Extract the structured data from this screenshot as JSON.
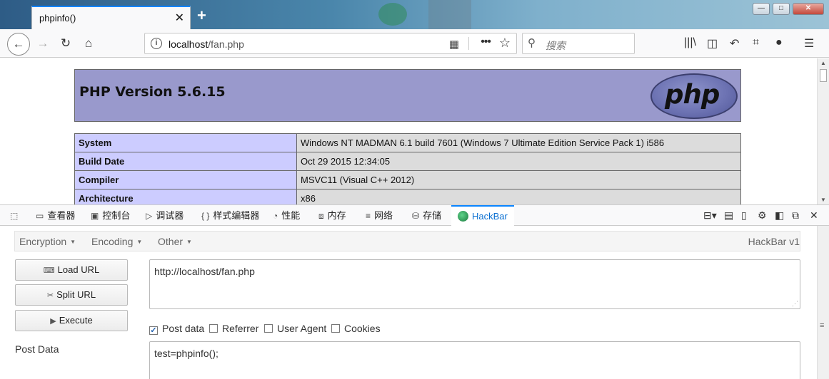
{
  "browser": {
    "tab_title": "phpinfo()",
    "tab_close": "✕",
    "new_tab": "+",
    "win_min": "—",
    "win_max": "□",
    "win_close": "✕",
    "url_host": "localhost",
    "url_path": "/fan.php",
    "search_placeholder": "搜索"
  },
  "page": {
    "php_version": "PHP Version 5.6.15",
    "logo_text": "php",
    "rows": [
      {
        "key": "System",
        "value": "Windows NT MADMAN 6.1 build 7601 (Windows 7 Ultimate Edition Service Pack 1) i586"
      },
      {
        "key": "Build Date",
        "value": "Oct 29 2015 12:34:05"
      },
      {
        "key": "Compiler",
        "value": "MSVC11 (Visual C++ 2012)"
      },
      {
        "key": "Architecture",
        "value": "x86"
      }
    ]
  },
  "devtools": {
    "tabs": [
      {
        "label": "查看器",
        "icon": "inspector-icon"
      },
      {
        "label": "控制台",
        "icon": "console-icon"
      },
      {
        "label": "调试器",
        "icon": "debugger-icon"
      },
      {
        "label": "样式编辑器",
        "icon": "style-editor-icon"
      },
      {
        "label": "性能",
        "icon": "performance-icon"
      },
      {
        "label": "内存",
        "icon": "memory-icon"
      },
      {
        "label": "网络",
        "icon": "network-icon"
      },
      {
        "label": "存储",
        "icon": "storage-icon"
      },
      {
        "label": "HackBar",
        "icon": "hackbar-icon",
        "active": true
      }
    ]
  },
  "hackbar": {
    "menu": [
      "Encryption",
      "Encoding",
      "Other"
    ],
    "version": "HackBar v1",
    "buttons": {
      "load": "Load URL",
      "split": "Split URL",
      "execute": "Execute"
    },
    "url_value": "http://localhost/fan.php",
    "checkboxes": [
      {
        "label": "Post data",
        "checked": true
      },
      {
        "label": "Referrer",
        "checked": false
      },
      {
        "label": "User Agent",
        "checked": false
      },
      {
        "label": "Cookies",
        "checked": false
      }
    ],
    "post_label": "Post Data",
    "post_value": "test=phpinfo();"
  },
  "colors": {
    "accent": "#0a84ff",
    "php_header": "#9999cc",
    "php_key": "#ccccff",
    "php_value": "#dcdcdc"
  }
}
